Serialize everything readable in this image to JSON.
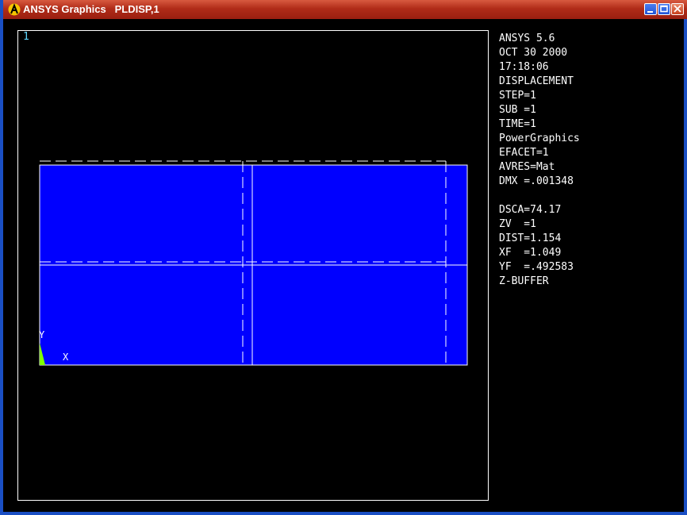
{
  "window": {
    "title": "ANSYS Graphics   PLDISP,1",
    "buttons": [
      "minimize",
      "maximize",
      "close"
    ]
  },
  "graphics": {
    "window_number": "1",
    "info_lines": [
      "ANSYS 5.6",
      "OCT 30 2000",
      "17:18:06",
      "DISPLACEMENT",
      "STEP=1",
      "SUB =1",
      "TIME=1",
      "PowerGraphics",
      "EFACET=1",
      "AVRES=Mat",
      "DMX =.001348",
      "",
      "DSCA=74.17",
      "ZV  =1",
      "DIST=1.154",
      "XF  =1.049",
      "YF  =.492583",
      "Z-BUFFER"
    ],
    "triad": {
      "y_label": "Y",
      "x_label": "X"
    },
    "colors": {
      "deformed_fill": "#0000ff",
      "mesh_lines": "#ffffff",
      "triad": "#7fff00",
      "window_number": "#5fd7ff",
      "background": "#000000"
    }
  }
}
